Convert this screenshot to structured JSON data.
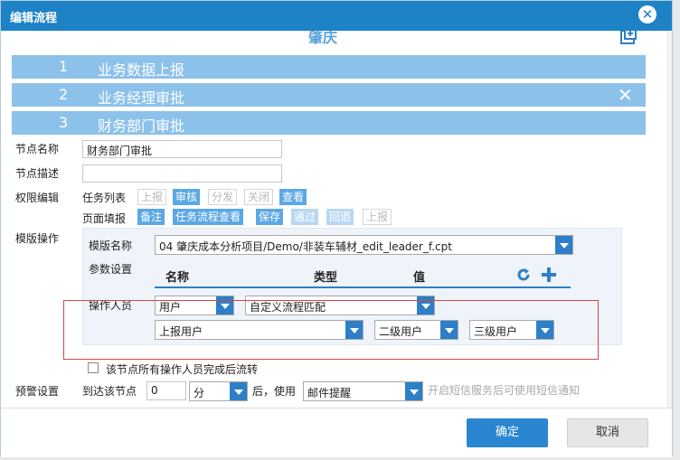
{
  "dialog": {
    "title": "编辑流程",
    "area_title": "肇庆"
  },
  "steps": [
    {
      "num": "1",
      "label": "业务数据上报"
    },
    {
      "num": "2",
      "label": "业务经理审批"
    },
    {
      "num": "3",
      "label": "财务部门审批"
    }
  ],
  "form": {
    "node_name_label": "节点名称",
    "node_name_value": "财务部门审批",
    "node_desc_label": "节点描述",
    "node_desc_value": "",
    "permission_label": "权限编辑",
    "task_list_label": "任务列表",
    "task_buttons": [
      "上报",
      "审核",
      "分发",
      "关闭",
      "查看"
    ],
    "page_fill_label": "页面填报",
    "page_buttons": [
      "备注",
      "任务流程查看",
      "保存",
      "通过",
      "回退",
      "上报"
    ],
    "template_op_label": "模版操作",
    "template_name_label": "模版名称",
    "template_name_value": "04 肇庆成本分析项目/Demo/非装车辅材_edit_leader_f.cpt",
    "param_label": "参数设置",
    "param_headers": {
      "name": "名称",
      "type": "类型",
      "value": "值"
    },
    "operator_label": "操作人员",
    "operator_type": "用户",
    "operator_match": "自定义流程匹配",
    "report_user": "上报用户",
    "level2_user": "二级用户",
    "level3_user": "三级用户",
    "checkbox_label": "该节点所有操作人员完成后流转",
    "warning_label": "预警设置",
    "arrive_label": "到达该节点",
    "arrive_value": "0",
    "unit_value": "分",
    "after_use_label": "后，使用",
    "notify_value": "邮件提醒",
    "sms_hint": "开启短信服务后可使用短信通知"
  },
  "footer": {
    "ok": "确定",
    "cancel": "取消"
  },
  "colors": {
    "accent": "#1d82c6",
    "step_bar": "#8cc1ea",
    "highlight_box": "#d84545"
  }
}
